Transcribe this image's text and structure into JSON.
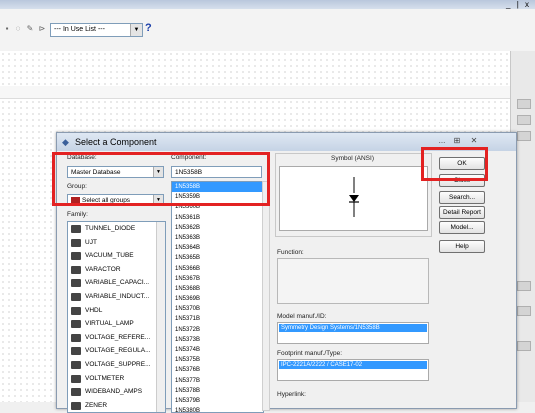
{
  "toolbar": {
    "in_use_list": "--- In Use List ---",
    "help": "?",
    "window_buttons": "_ | x"
  },
  "dialog": {
    "title": "Select a Component",
    "title_buttons": {
      "min": "...",
      "max": "⊞",
      "close": "✕"
    },
    "database_label": "Database:",
    "database_value": "Master Database",
    "group_label": "Group:",
    "group_value": "Select all groups",
    "family_label": "Family:",
    "families": [
      {
        "icon": "diode",
        "label": "TUNNEL_DIODE"
      },
      {
        "icon": "jfet",
        "label": "UJT"
      },
      {
        "icon": "tube",
        "label": "VACUUM_TUBE"
      },
      {
        "icon": "varactor",
        "label": "VARACTOR"
      },
      {
        "icon": "cap",
        "label": "VARIABLE_CAPACI..."
      },
      {
        "icon": "ind",
        "label": "VARIABLE_INDUCT..."
      },
      {
        "icon": "vhdl",
        "label": "VHDL"
      },
      {
        "icon": "lamp",
        "label": "VIRTUAL_LAMP"
      },
      {
        "icon": "vref",
        "label": "VOLTAGE_REFERE..."
      },
      {
        "icon": "vreg",
        "label": "VOLTAGE_REGULA..."
      },
      {
        "icon": "vsup",
        "label": "VOLTAGE_SUPPRE..."
      },
      {
        "icon": "meter",
        "label": "VOLTMETER"
      },
      {
        "icon": "amp",
        "label": "WIDEBAND_AMPS"
      },
      {
        "icon": "zener",
        "label": "ZENER"
      }
    ],
    "component_label": "Component:",
    "component_value": "1N5358B",
    "components": [
      "1N5358B",
      "1N5359B",
      "1N5360B",
      "1N5361B",
      "1N5362B",
      "1N5363B",
      "1N5364B",
      "1N5365B",
      "1N5366B",
      "1N5367B",
      "1N5368B",
      "1N5369B",
      "1N5370B",
      "1N5371B",
      "1N5372B",
      "1N5373B",
      "1N5374B",
      "1N5375B",
      "1N5376B",
      "1N5377B",
      "1N5378B",
      "1N5379B",
      "1N5380B"
    ],
    "selected_index": 0,
    "symbol_label": "Symbol (ANSI)",
    "function_label": "Function:",
    "model_label": "Model manuf./ID:",
    "model_value": "Symmetry Design Systems/1N5358B",
    "footprint_label": "Footprint manuf./Type:",
    "footprint_value": "IPC-2221A/2222 / CASE17-02",
    "hyperlink_label": "Hyperlink:",
    "buttons": {
      "ok": "OK",
      "close": "Close",
      "search": "Search...",
      "detail": "Detail Report",
      "model": "Model...",
      "help": "Help"
    }
  },
  "colors": {
    "highlight": "#e32222",
    "selection": "#3399ff"
  }
}
